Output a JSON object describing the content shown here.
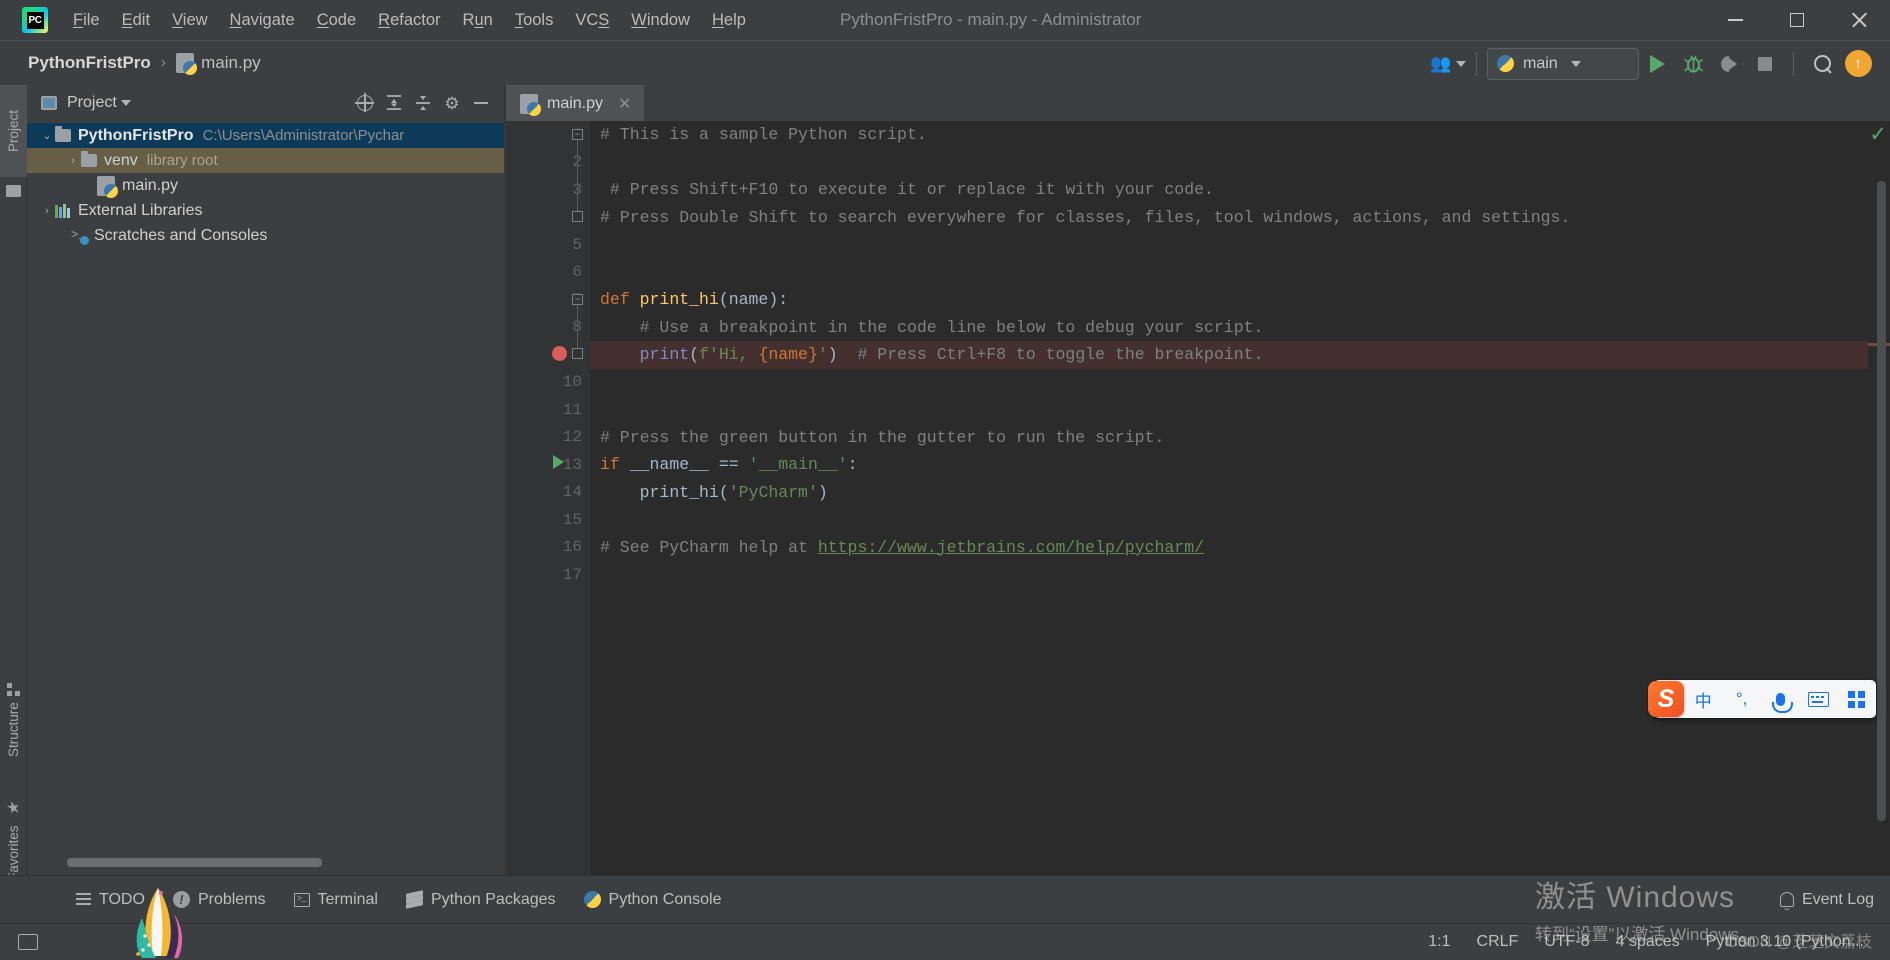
{
  "window": {
    "title": "PythonFristPro - main.py - Administrator",
    "app_icon": "pycharm-logo-icon",
    "minimize_label": "—",
    "maximize_label": "□",
    "close_label": "✕"
  },
  "menubar": {
    "items": [
      {
        "label": "File",
        "mnemonic": "F"
      },
      {
        "label": "Edit",
        "mnemonic": "E"
      },
      {
        "label": "View",
        "mnemonic": "V"
      },
      {
        "label": "Navigate",
        "mnemonic": "N"
      },
      {
        "label": "Code",
        "mnemonic": "C"
      },
      {
        "label": "Refactor",
        "mnemonic": "R"
      },
      {
        "label": "Run",
        "mnemonic": "u"
      },
      {
        "label": "Tools",
        "mnemonic": "T"
      },
      {
        "label": "VCS",
        "mnemonic": "S"
      },
      {
        "label": "Window",
        "mnemonic": "W"
      },
      {
        "label": "Help",
        "mnemonic": "H"
      }
    ]
  },
  "navbar": {
    "breadcrumb_project": "PythonFristPro",
    "breadcrumb_separator": "›",
    "breadcrumb_file": "main.py",
    "run_config": "main",
    "toolbar_icons": [
      {
        "name": "people-icon",
        "glyph": "👥"
      },
      {
        "name": "run-icon",
        "glyph": "▶"
      },
      {
        "name": "debug-icon",
        "glyph": "🐞"
      },
      {
        "name": "coverage-icon",
        "glyph": "◑"
      },
      {
        "name": "stop-icon",
        "glyph": "■"
      },
      {
        "name": "search-icon",
        "glyph": "🔍"
      },
      {
        "name": "update-icon",
        "glyph": "↑"
      }
    ],
    "update_badge": "↑"
  },
  "left_tool_strip": {
    "tabs": [
      {
        "label": "Project",
        "icon": "folder-icon",
        "active": true
      },
      {
        "label": "Structure",
        "icon": "structure-icon",
        "active": false
      },
      {
        "label": "Favorites",
        "icon": "star-icon",
        "active": false
      }
    ]
  },
  "project_panel": {
    "title": "Project",
    "header_icons": [
      {
        "name": "select-opened-file-icon"
      },
      {
        "name": "expand-all-icon"
      },
      {
        "name": "collapse-all-icon"
      },
      {
        "name": "settings-gear-icon"
      },
      {
        "name": "hide-panel-icon"
      }
    ],
    "tree": [
      {
        "label": "PythonFristPro",
        "sub": "C:\\Users\\Administrator\\Pychar",
        "indent": 0,
        "arrow": "⌄",
        "icon": "folder-icon",
        "bold": true,
        "selected": "blue"
      },
      {
        "label": "venv",
        "sub": "library root",
        "indent": 1,
        "arrow": "›",
        "icon": "folder-icon",
        "bold": false,
        "selected": "olive"
      },
      {
        "label": "main.py",
        "sub": "",
        "indent": 2,
        "arrow": "",
        "icon": "python-file-icon",
        "bold": false,
        "selected": ""
      },
      {
        "label": "External Libraries",
        "sub": "",
        "indent": 0,
        "arrow": "›",
        "icon": "library-icon",
        "bold": false,
        "selected": ""
      },
      {
        "label": "Scratches and Consoles",
        "sub": "",
        "indent": 1,
        "arrow": "",
        "icon": "scratch-icon",
        "bold": false,
        "selected": ""
      }
    ]
  },
  "editor": {
    "tab": {
      "label": "main.py",
      "close": "✕",
      "icon": "python-file-icon"
    },
    "inspection_status": "✓",
    "lines": [
      {
        "n": 1,
        "segments": [
          {
            "t": "# This is a sample Python script.",
            "c": "cmt"
          }
        ],
        "fold": "minus",
        "breakpoint": false,
        "run_marker": false,
        "highlight": false
      },
      {
        "n": 2,
        "segments": [],
        "fold": "",
        "breakpoint": false,
        "run_marker": false,
        "highlight": false
      },
      {
        "n": 3,
        "segments": [
          {
            "t": " # Press Shift+F10 to execute it or replace it with your code.",
            "c": "cmt"
          }
        ],
        "fold": "",
        "breakpoint": false,
        "run_marker": false,
        "highlight": false
      },
      {
        "n": 4,
        "segments": [
          {
            "t": "# Press Double Shift to search everywhere for classes, files, tool windows, actions, and settings.",
            "c": "cmt"
          }
        ],
        "fold": "end",
        "breakpoint": false,
        "run_marker": false,
        "highlight": false
      },
      {
        "n": 5,
        "segments": [],
        "fold": "",
        "breakpoint": false,
        "run_marker": false,
        "highlight": false
      },
      {
        "n": 6,
        "segments": [],
        "fold": "",
        "breakpoint": false,
        "run_marker": false,
        "highlight": false
      },
      {
        "n": 7,
        "segments": [
          {
            "t": "def ",
            "c": "kw"
          },
          {
            "t": "print_hi",
            "c": "fn"
          },
          {
            "t": "(name):",
            "c": "ident"
          }
        ],
        "fold": "minus",
        "breakpoint": false,
        "run_marker": false,
        "highlight": false
      },
      {
        "n": 8,
        "segments": [
          {
            "t": "    # Use a breakpoint in the code line below to debug your script.",
            "c": "cmt"
          }
        ],
        "fold": "",
        "breakpoint": false,
        "run_marker": false,
        "highlight": false
      },
      {
        "n": 9,
        "segments": [
          {
            "t": "    ",
            "c": "ident"
          },
          {
            "t": "print",
            "c": "bi"
          },
          {
            "t": "(",
            "c": "ident"
          },
          {
            "t": "f'Hi, ",
            "c": "str"
          },
          {
            "t": "{name}",
            "c": "kw"
          },
          {
            "t": "'",
            "c": "str"
          },
          {
            "t": ")  ",
            "c": "ident"
          },
          {
            "t": "# Press Ctrl+F8 to toggle the breakpoint.",
            "c": "cmt"
          }
        ],
        "fold": "end",
        "breakpoint": true,
        "run_marker": false,
        "highlight": true
      },
      {
        "n": 10,
        "segments": [],
        "fold": "",
        "breakpoint": false,
        "run_marker": false,
        "highlight": false
      },
      {
        "n": 11,
        "segments": [],
        "fold": "",
        "breakpoint": false,
        "run_marker": false,
        "highlight": false
      },
      {
        "n": 12,
        "segments": [
          {
            "t": "# Press the green button in the gutter to run the script.",
            "c": "cmt"
          }
        ],
        "fold": "",
        "breakpoint": false,
        "run_marker": false,
        "highlight": false
      },
      {
        "n": 13,
        "segments": [
          {
            "t": "if ",
            "c": "kw"
          },
          {
            "t": "__name__ ",
            "c": "ident"
          },
          {
            "t": "== ",
            "c": "ident"
          },
          {
            "t": "'__main__'",
            "c": "str"
          },
          {
            "t": ":",
            "c": "ident"
          }
        ],
        "fold": "",
        "breakpoint": false,
        "run_marker": true,
        "highlight": false
      },
      {
        "n": 14,
        "segments": [
          {
            "t": "    ",
            "c": "ident"
          },
          {
            "t": "print_hi",
            "c": "ident"
          },
          {
            "t": "(",
            "c": "ident"
          },
          {
            "t": "'PyCharm'",
            "c": "str"
          },
          {
            "t": ")",
            "c": "ident"
          }
        ],
        "fold": "",
        "breakpoint": false,
        "run_marker": false,
        "highlight": false
      },
      {
        "n": 15,
        "segments": [],
        "fold": "",
        "breakpoint": false,
        "run_marker": false,
        "highlight": false
      },
      {
        "n": 16,
        "segments": [
          {
            "t": "# See PyCharm help at ",
            "c": "cmt"
          },
          {
            "t": "https://www.jetbrains.com/help/pycharm/",
            "c": "link"
          }
        ],
        "fold": "",
        "breakpoint": false,
        "run_marker": false,
        "highlight": false
      },
      {
        "n": 17,
        "segments": [],
        "fold": "",
        "breakpoint": false,
        "run_marker": false,
        "highlight": false
      }
    ]
  },
  "bottom_toolwindows": {
    "items": [
      {
        "label": "TODO",
        "icon": "todo-icon"
      },
      {
        "label": "Problems",
        "icon": "problems-icon"
      },
      {
        "label": "Terminal",
        "icon": "terminal-icon"
      },
      {
        "label": "Python Packages",
        "icon": "packages-icon"
      },
      {
        "label": "Python Console",
        "icon": "python-console-icon"
      }
    ],
    "event_log": "Event Log"
  },
  "statusbar": {
    "layout_icon": "layout-icon",
    "caret_position": "1:1",
    "line_separator": "CRLF",
    "encoding": "UTF-8",
    "indent": "4 spaces",
    "interpreter": "Python 3.10 (Python..."
  },
  "ime": {
    "logo": "S",
    "mode": "中",
    "punctuation": "°,",
    "mic": "mic-icon",
    "keyboard": "keyboard-icon",
    "apps": "apps-grid-icon"
  },
  "watermark": {
    "line1": "激活 Windows",
    "line2": "转到“设置”以激活 Windows。",
    "credit": "CSDN @芝芝文荔枝"
  },
  "colors": {
    "chrome": "#3c3f41",
    "editor_bg": "#2b2b2b",
    "gutter_bg": "#313335",
    "accent_green": "#59a869",
    "accent_orange": "#f0a732",
    "selection_blue": "#0d3a58",
    "selection_olive": "#665f45",
    "breakpoint_red": "#db5c5c",
    "highlight_line": "#43302f",
    "keyword": "#cc7832",
    "string": "#6a8759",
    "function": "#ffc66d",
    "builtin": "#8888c6",
    "comment": "#808080",
    "ime_blue": "#1a73e8"
  }
}
